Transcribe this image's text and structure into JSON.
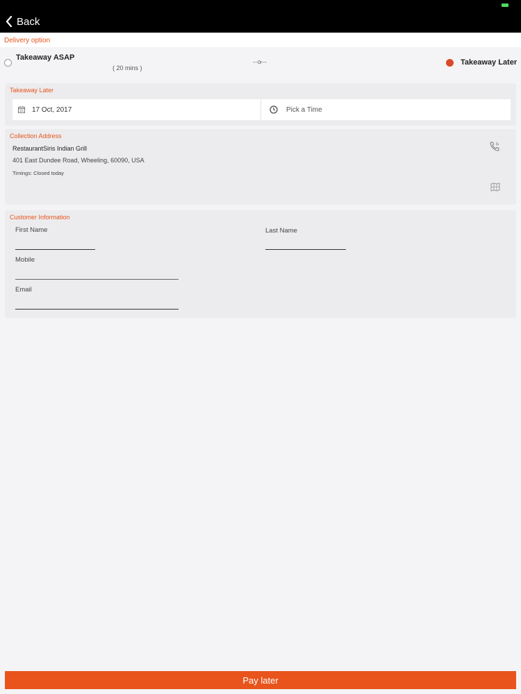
{
  "nav": {
    "back_label": "Back"
  },
  "delivery": {
    "section_label": "Delivery option",
    "asap_label": "Takeaway ASAP",
    "asap_time": "( 20 mins )",
    "or_text": "---0r---",
    "later_label": "Takeaway Later",
    "selected": "Takeaway Later"
  },
  "takeaway_later": {
    "title": "Takeaway Later",
    "date_value": "17 Oct, 2017",
    "time_placeholder": "Pick a Time"
  },
  "collection": {
    "title": "Collection Address",
    "restaurant_name": "RestaurantSiris Indian Grill",
    "address": "401 East Dundee Road, Wheeling, 60090, USA",
    "timings": "Timings: Closed today"
  },
  "customer": {
    "title": "Customer Information",
    "first_name_label": "First Name",
    "last_name_label": "Last Name",
    "mobile_label": "Mobile",
    "email_label": "Email"
  },
  "footer": {
    "pay_label": "Pay later"
  },
  "colors": {
    "accent": "#e8541c",
    "radio_selected": "#d84a28",
    "topbar": "#000000"
  }
}
